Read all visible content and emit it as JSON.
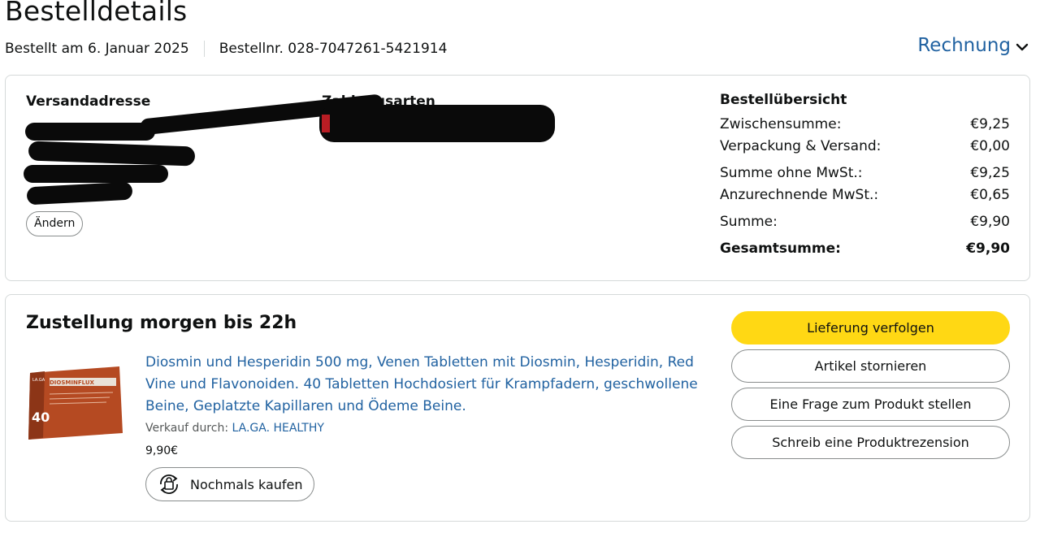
{
  "page": {
    "title": "Bestelldetails",
    "ordered_on": "Bestellt am 6. Januar 2025",
    "order_number": "Bestellnr. 028-7047261-5421914",
    "invoice_label": "Rechnung"
  },
  "shipping": {
    "title": "Versandadresse",
    "change_label": "Ändern"
  },
  "payment": {
    "title": "Zahlungsarten"
  },
  "summary": {
    "title": "Bestellübersicht",
    "rows": [
      {
        "label": "Zwischensumme:",
        "value": "€9,25"
      },
      {
        "label": "Verpackung & Versand:",
        "value": "€0,00"
      },
      {
        "label": "Summe ohne MwSt.:",
        "value": "€9,25"
      },
      {
        "label": "Anzurechnende MwSt.:",
        "value": "€0,65"
      },
      {
        "label": "Summe:",
        "value": "€9,90"
      },
      {
        "label": "Gesamtsumme:",
        "value": "€9,90"
      }
    ]
  },
  "delivery": {
    "title": "Zustellung morgen bis 22h",
    "product_title": "Diosmin und Hesperidin 500 mg, Venen Tabletten mit Diosmin, Hesperidin, Red Vine und Flavonoiden. 40 Tabletten Hochdosiert für Krampfadern, geschwollene Beine, Geplatzte Kapillaren und Ödeme Beine.",
    "seller_prefix": "Verkauf durch:",
    "seller_name": "LA.GA. HEALTHY",
    "price": "9,90€",
    "rebuy_label": "Nochmals kaufen",
    "image": {
      "brand": "DIOSMINFLUX",
      "count": "40",
      "maker": "LA.GA"
    }
  },
  "actions": {
    "track": "Lieferung verfolgen",
    "cancel": "Artikel stornieren",
    "question": "Eine Frage zum Produkt stellen",
    "review": "Schreib eine Produktrezension"
  },
  "colors": {
    "link": "#2162a1",
    "primary_button": "#ffd814",
    "border": "#d5d9d9",
    "product_box": "#b54a22"
  }
}
